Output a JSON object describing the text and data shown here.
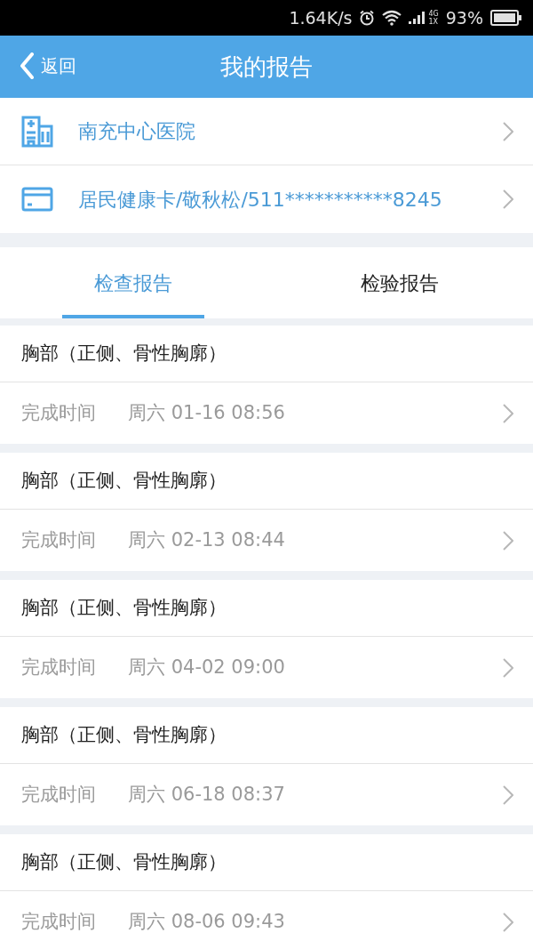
{
  "status_bar": {
    "speed": "1.64K/s",
    "network_top": "4G",
    "network_bottom": "1X",
    "battery": "93%"
  },
  "header": {
    "back": "返回",
    "title": "我的报告"
  },
  "info_rows": [
    {
      "kind": "hospital",
      "label": "南充中心医院"
    },
    {
      "kind": "card",
      "label": "居民健康卡/敬秋松/511***********8245"
    }
  ],
  "tabs": [
    {
      "label": "检查报告",
      "selected": true
    },
    {
      "label": "检验报告",
      "selected": false
    }
  ],
  "reports": [
    {
      "title": "胸部（正侧、骨性胸廓）",
      "time_label": "完成时间",
      "time": "周六 01-16 08:56"
    },
    {
      "title": "胸部（正侧、骨性胸廓）",
      "time_label": "完成时间",
      "time": "周六 02-13 08:44"
    },
    {
      "title": "胸部（正侧、骨性胸廓）",
      "time_label": "完成时间",
      "time": "周六 04-02 09:00"
    },
    {
      "title": "胸部（正侧、骨性胸廓）",
      "time_label": "完成时间",
      "time": "周六 06-18 08:37"
    },
    {
      "title": "胸部（正侧、骨性胸廓）",
      "time_label": "完成时间",
      "time": "周六 08-06 09:43"
    }
  ]
}
